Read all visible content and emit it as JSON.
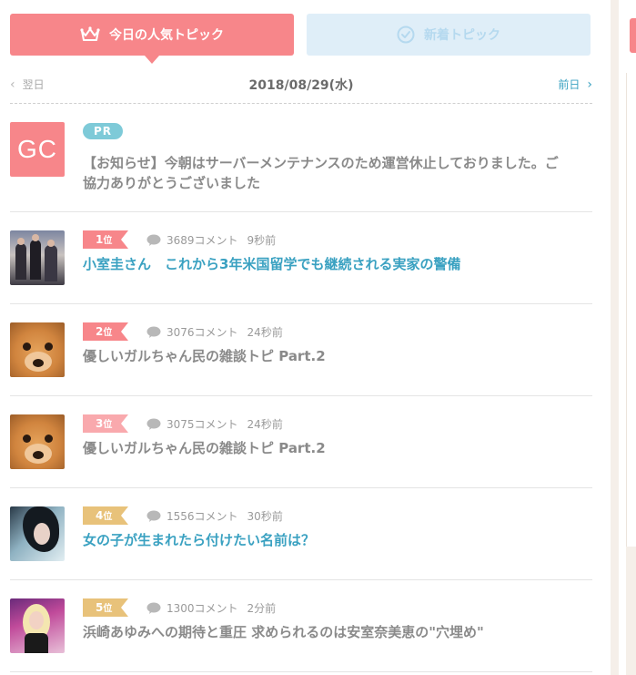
{
  "tabs": {
    "popular": {
      "label": "今日の人気トピック",
      "icon": "crown-icon"
    },
    "new": {
      "label": "新着トピック",
      "icon": "clock-icon"
    }
  },
  "date_nav": {
    "prev_label": "翌日",
    "date": "2018/08/29(水)",
    "next_label": "前日"
  },
  "colors": {
    "accent_pink": "#f7868a",
    "accent_blue": "#3aa1c1",
    "pr_badge": "#7ecad8",
    "rank_1": "#f7868a",
    "rank_2": "#f7868a",
    "rank_3": "#f9a9ad",
    "rank_4": "#e8c27a",
    "rank_5": "#e8c27a"
  },
  "topics": [
    {
      "type": "pr",
      "badge": "PR",
      "thumb_text": "GC",
      "title": "【お知らせ】今朝はサーバーメンテナンスのため運営休止しておりました。ご協力ありがとうございました"
    },
    {
      "rank": "1",
      "rank_suffix": "位",
      "comments": "3689コメント",
      "time": "9秒前",
      "title": "小室圭さん　これから3年米国留学でも継続される実家の警備"
    },
    {
      "rank": "2",
      "rank_suffix": "位",
      "comments": "3076コメント",
      "time": "24秒前",
      "title": "優しいガルちゃん民の雑談トピ Part.2"
    },
    {
      "rank": "3",
      "rank_suffix": "位",
      "comments": "3075コメント",
      "time": "24秒前",
      "title": "優しいガルちゃん民の雑談トピ Part.2"
    },
    {
      "rank": "4",
      "rank_suffix": "位",
      "comments": "1556コメント",
      "time": "30秒前",
      "title": "女の子が生まれたら付けたい名前は？"
    },
    {
      "rank": "5",
      "rank_suffix": "位",
      "comments": "1300コメント",
      "time": "2分前",
      "title": "浜崎あゆみへの期待と重圧 求められるのは安室奈美恵の\"穴埋め\""
    }
  ]
}
